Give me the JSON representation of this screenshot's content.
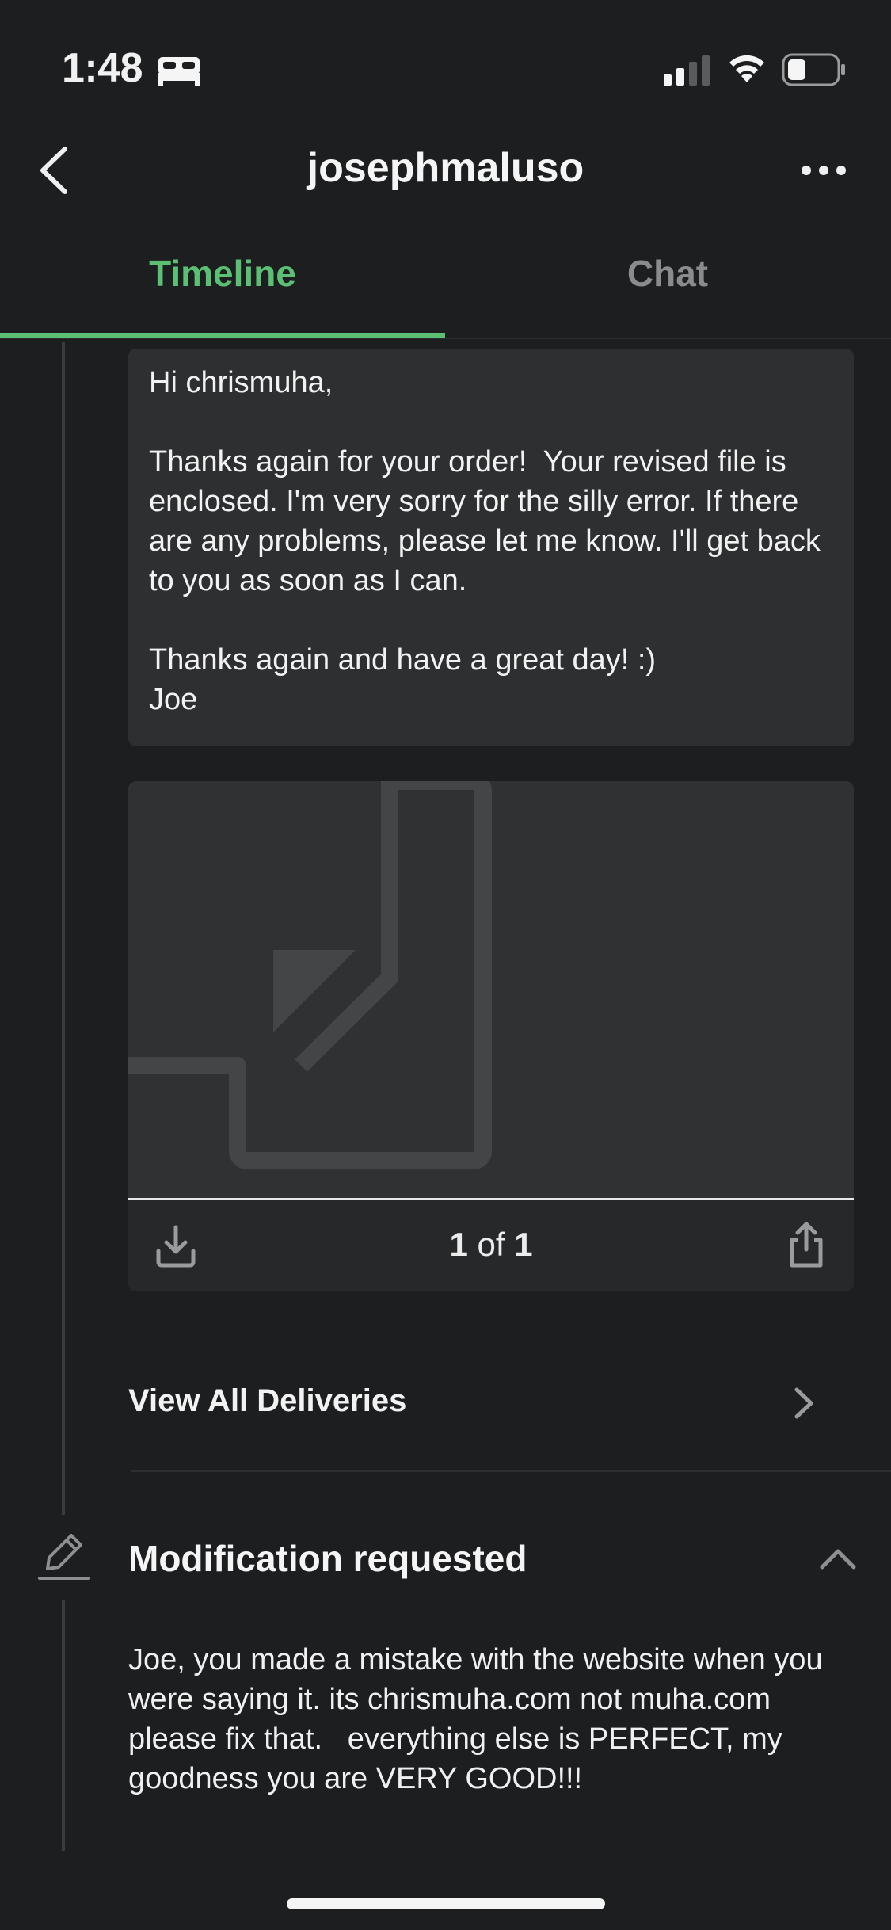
{
  "status_bar": {
    "time": "1:48",
    "icons": [
      "bed-icon",
      "signal-icon",
      "wifi-icon",
      "battery-icon"
    ]
  },
  "nav": {
    "title": "josephmaluso",
    "back_icon": "back-chevron-icon",
    "more_icon": "more-icon"
  },
  "tabs": [
    {
      "label": "Timeline",
      "active": true
    },
    {
      "label": "Chat",
      "active": false
    }
  ],
  "colors": {
    "accent": "#5bbf74",
    "background": "#1d1e20",
    "card": "#2e2f31",
    "inactive_tab": "#8a8b8d"
  },
  "message": {
    "text": "Hi chrismuha,\n\nThanks again for your order!  Your revised file is enclosed. I'm very sorry for the silly error. If there are any problems, please let me know. I'll get back to you as soon as I can.\n\nThanks again and have a great day! :)\nJoe"
  },
  "file_preview": {
    "current_page": "1",
    "of_label": "of",
    "total_pages": "1",
    "icons": [
      "download-icon",
      "share-icon",
      "document-icon"
    ]
  },
  "deliveries": {
    "view_all_label": "View All Deliveries"
  },
  "modification": {
    "title": "Modification requested",
    "text": "Joe, you made a mistake with the website when you were saying it. its chrismuha.com not muha.com  please fix that.   everything else is PERFECT, my goodness you are VERY GOOD!!!"
  }
}
